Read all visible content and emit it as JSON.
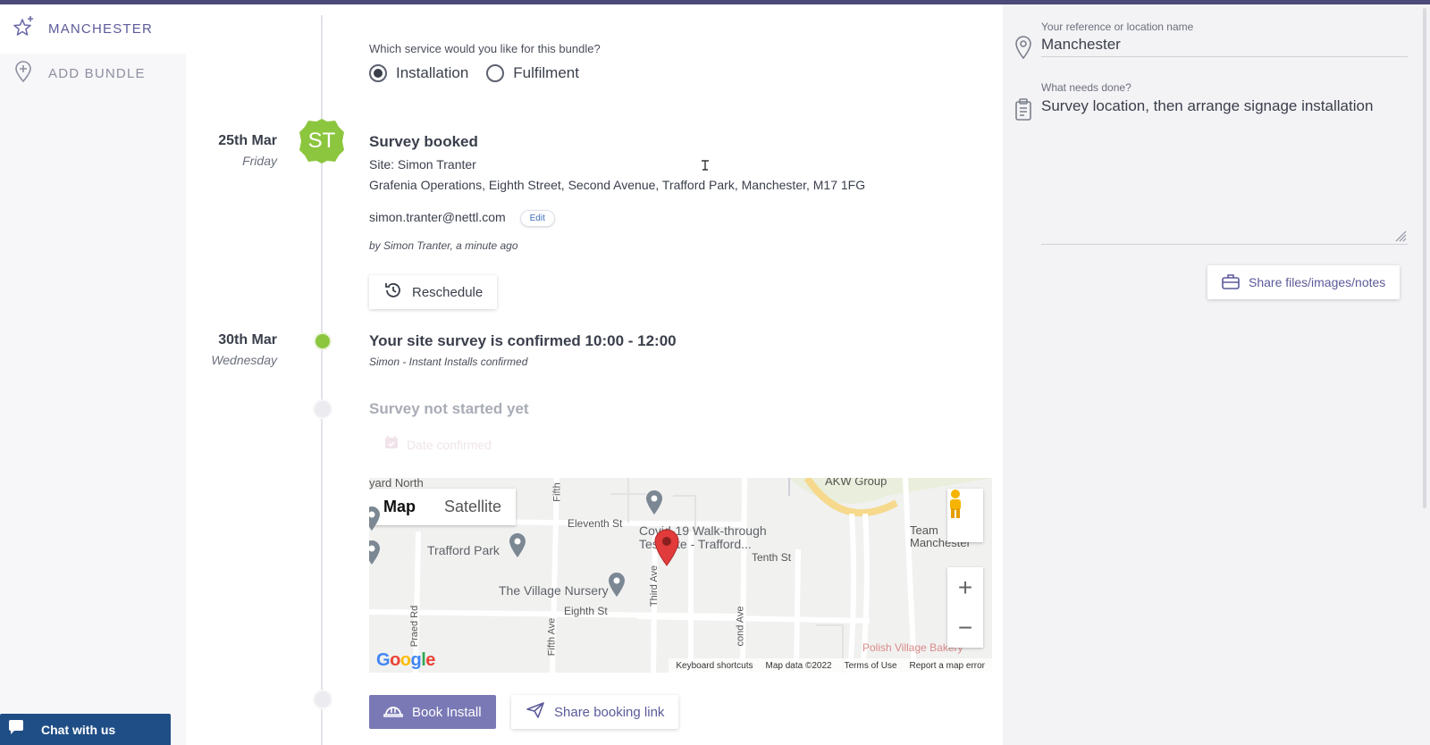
{
  "nav": {
    "items": [
      {
        "label": "MANCHESTER",
        "icon": "sparkle-star-icon"
      },
      {
        "label": "ADD BUNDLE",
        "icon": "map-pin-plus-icon"
      }
    ]
  },
  "chat": {
    "label": "Chat with us"
  },
  "service": {
    "question": "Which service would you like for this bundle?",
    "options": [
      "Installation",
      "Fulfilment"
    ],
    "selected": "Installation"
  },
  "events": {
    "survey_booked": {
      "date": "25th Mar",
      "day": "Friday",
      "avatar_initials": "ST",
      "title": "Survey booked",
      "site": "Site: Simon Tranter",
      "address": "Grafenia Operations, Eighth Street, Second Avenue, Trafford Park, Manchester, M17 1FG",
      "email": "simon.tranter@nettl.com",
      "edit_label": "Edit",
      "byline": "by Simon Tranter, a minute ago",
      "reschedule_label": "Reschedule"
    },
    "confirmed": {
      "date": "30th Mar",
      "day": "Wednesday",
      "title": "Your site survey is confirmed 10:00 - 12:00",
      "byline": "Simon - Instant Installs confirmed"
    },
    "not_started": {
      "title": "Survey not started yet",
      "date_confirmed": "Date confirmed"
    }
  },
  "map": {
    "type_options": [
      "Map",
      "Satellite"
    ],
    "selected_type": "Map",
    "labels": {
      "yard_north": "yard North",
      "akw_group": "AKW Group",
      "trafford_park": "Trafford Park",
      "covid_line1": "Covid-19 Walk-through",
      "covid_line2": "Test Site - Trafford...",
      "village_nursery": "The Village Nursery",
      "eleventh_st": "Eleventh St",
      "eighth_st": "Eighth St",
      "tenth_st": "Tenth St",
      "fifth": "Fifth",
      "fifth_ave": "Fifth Ave",
      "third_ave": "Third Ave",
      "second_ave": "cond Ave",
      "praed_rd": "Praed Rd",
      "team_manchester": "Team Manchester",
      "polish_village": "Polish Village Bakery"
    },
    "footer": {
      "shortcuts": "Keyboard shortcuts",
      "data": "Map data ©2022",
      "terms": "Terms of Use",
      "report": "Report a map error"
    },
    "brand": "Google"
  },
  "actions": {
    "book_install": "Book Install",
    "share_link": "Share booking link"
  },
  "details": {
    "ref_label": "Your reference or location name",
    "ref_value": "Manchester",
    "needs_label": "What needs done?",
    "needs_value": "Survey location, then arrange signage installation",
    "share_files": "Share files/images/notes"
  },
  "colors": {
    "accent": "#5b5a9a",
    "primary_button": "#7a79b6",
    "avatar_green": "#8cc63f",
    "chat_blue": "#1f4e86",
    "top_bar": "#4b4a78"
  }
}
